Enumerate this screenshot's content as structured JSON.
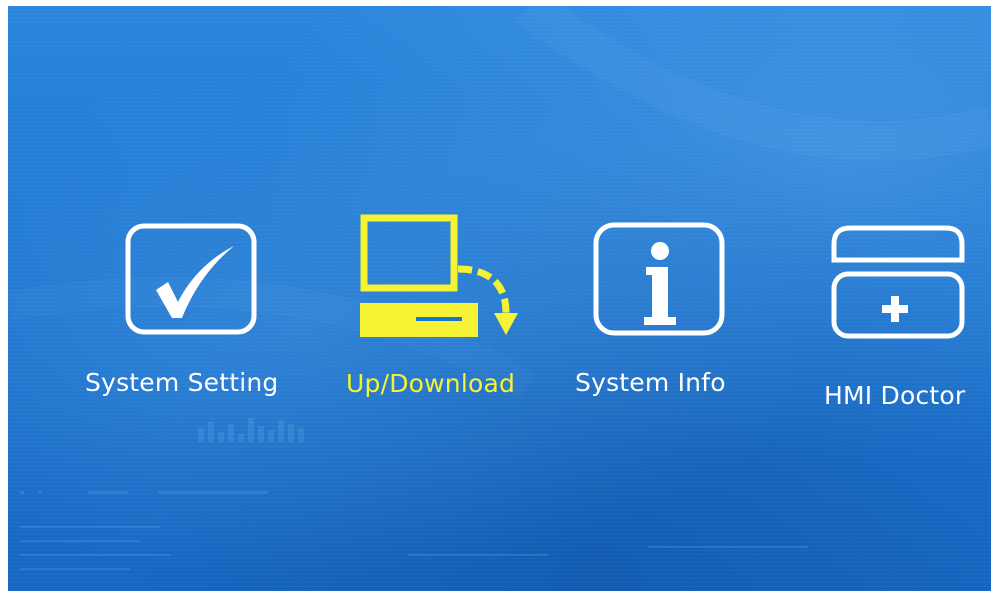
{
  "colors": {
    "background": "#1b74cf",
    "icon_default": "#ffffff",
    "icon_active": "#f6f234",
    "label_default": "#ffffff",
    "label_active": "#f6f234"
  },
  "menu": {
    "items": [
      {
        "label": "System Setting",
        "icon": "checkmark-box-icon",
        "active": false
      },
      {
        "label": "Up/Download",
        "icon": "computer-download-icon",
        "active": true
      },
      {
        "label": "System Info",
        "icon": "info-icon",
        "active": false
      },
      {
        "label": "HMI Doctor",
        "icon": "hmi-doctor-icon",
        "active": false
      }
    ]
  }
}
